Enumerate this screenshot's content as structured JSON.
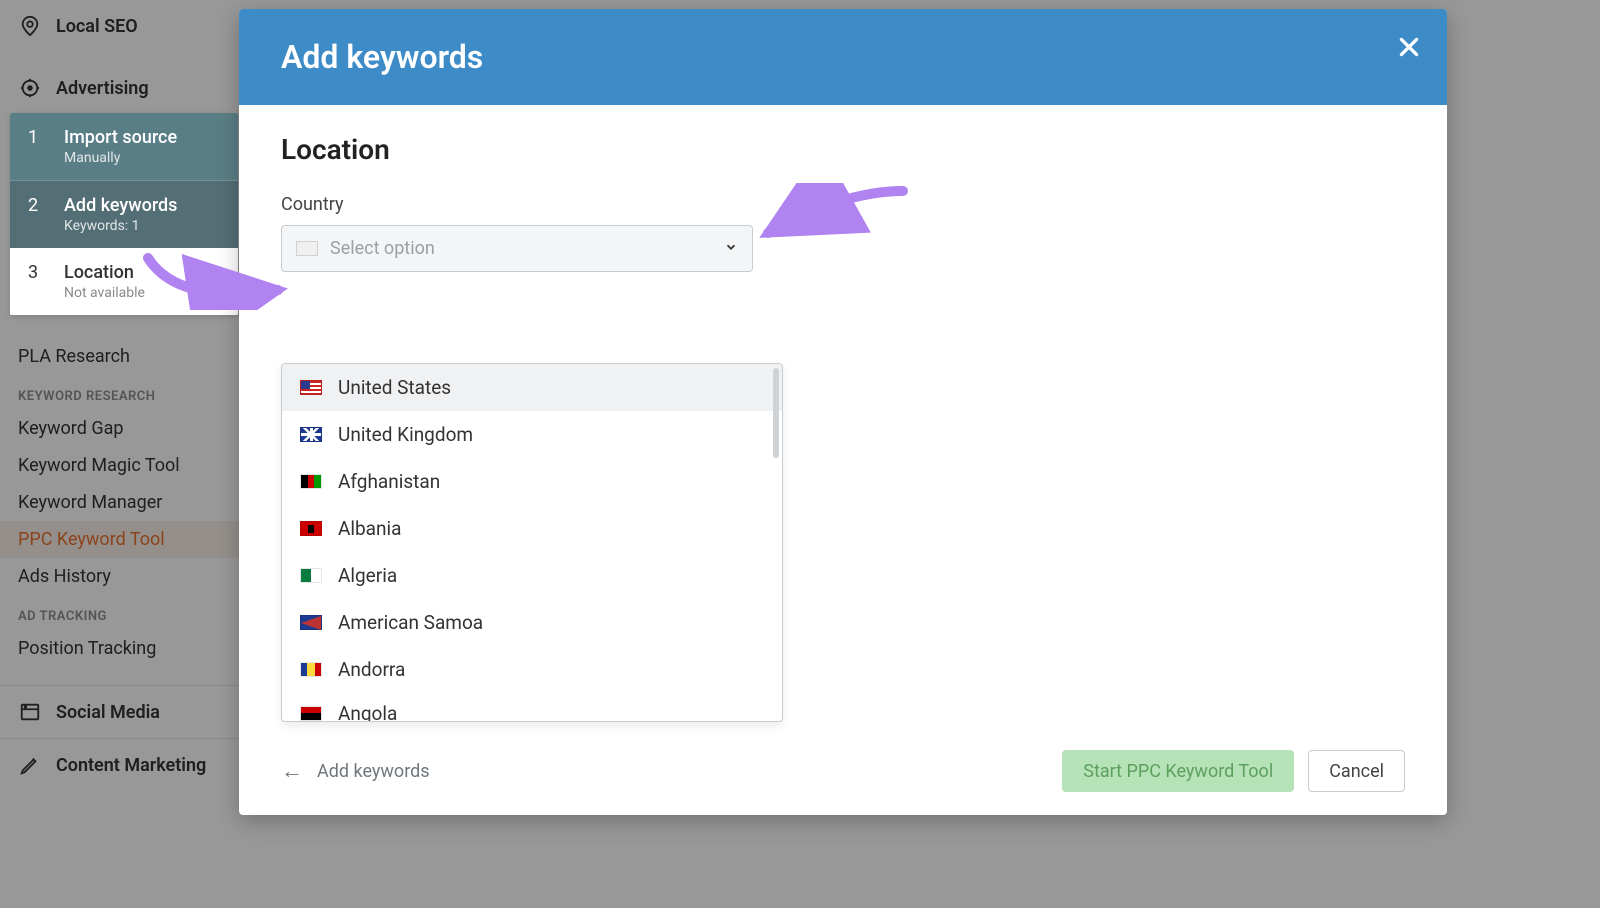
{
  "sidebar": {
    "items": [
      {
        "label": "Local SEO",
        "icon": "pin",
        "bold": true,
        "chevron": true
      },
      {
        "label": "Advertising",
        "icon": "target",
        "bold": true,
        "chevron": true
      }
    ],
    "pla": "PLA Research",
    "section_kw": "KEYWORD RESEARCH",
    "kw_links": [
      "Keyword Gap",
      "Keyword Magic Tool",
      "Keyword Manager",
      "PPC Keyword Tool",
      "Ads History"
    ],
    "active_kw_index": 3,
    "section_ad": "AD TRACKING",
    "ad_links": [
      "Position Tracking"
    ],
    "lower": [
      {
        "label": "Social Media",
        "icon": "window"
      },
      {
        "label": "Content Marketing",
        "icon": "pencil"
      }
    ]
  },
  "steps": [
    {
      "num": "1",
      "title": "Import source",
      "sub": "Manually",
      "state": "done"
    },
    {
      "num": "2",
      "title": "Add keywords",
      "sub": "Keywords: 1",
      "state": "current"
    },
    {
      "num": "3",
      "title": "Location",
      "sub": "Not available",
      "state": "future"
    }
  ],
  "modal": {
    "title": "Add keywords",
    "section_title": "Location",
    "country_label": "Country",
    "placeholder": "Select option",
    "footer_back": "Add keywords",
    "btn_start": "Start PPC Keyword Tool",
    "btn_cancel": "Cancel"
  },
  "dropdown": {
    "options": [
      {
        "label": "United States",
        "flag": "us",
        "highlighted": true
      },
      {
        "label": "United Kingdom",
        "flag": "gb"
      },
      {
        "label": "Afghanistan",
        "flag": "af"
      },
      {
        "label": "Albania",
        "flag": "al"
      },
      {
        "label": "Algeria",
        "flag": "dz"
      },
      {
        "label": "American Samoa",
        "flag": "as"
      },
      {
        "label": "Andorra",
        "flag": "ad"
      },
      {
        "label": "Angola",
        "flag": "ao"
      }
    ]
  }
}
